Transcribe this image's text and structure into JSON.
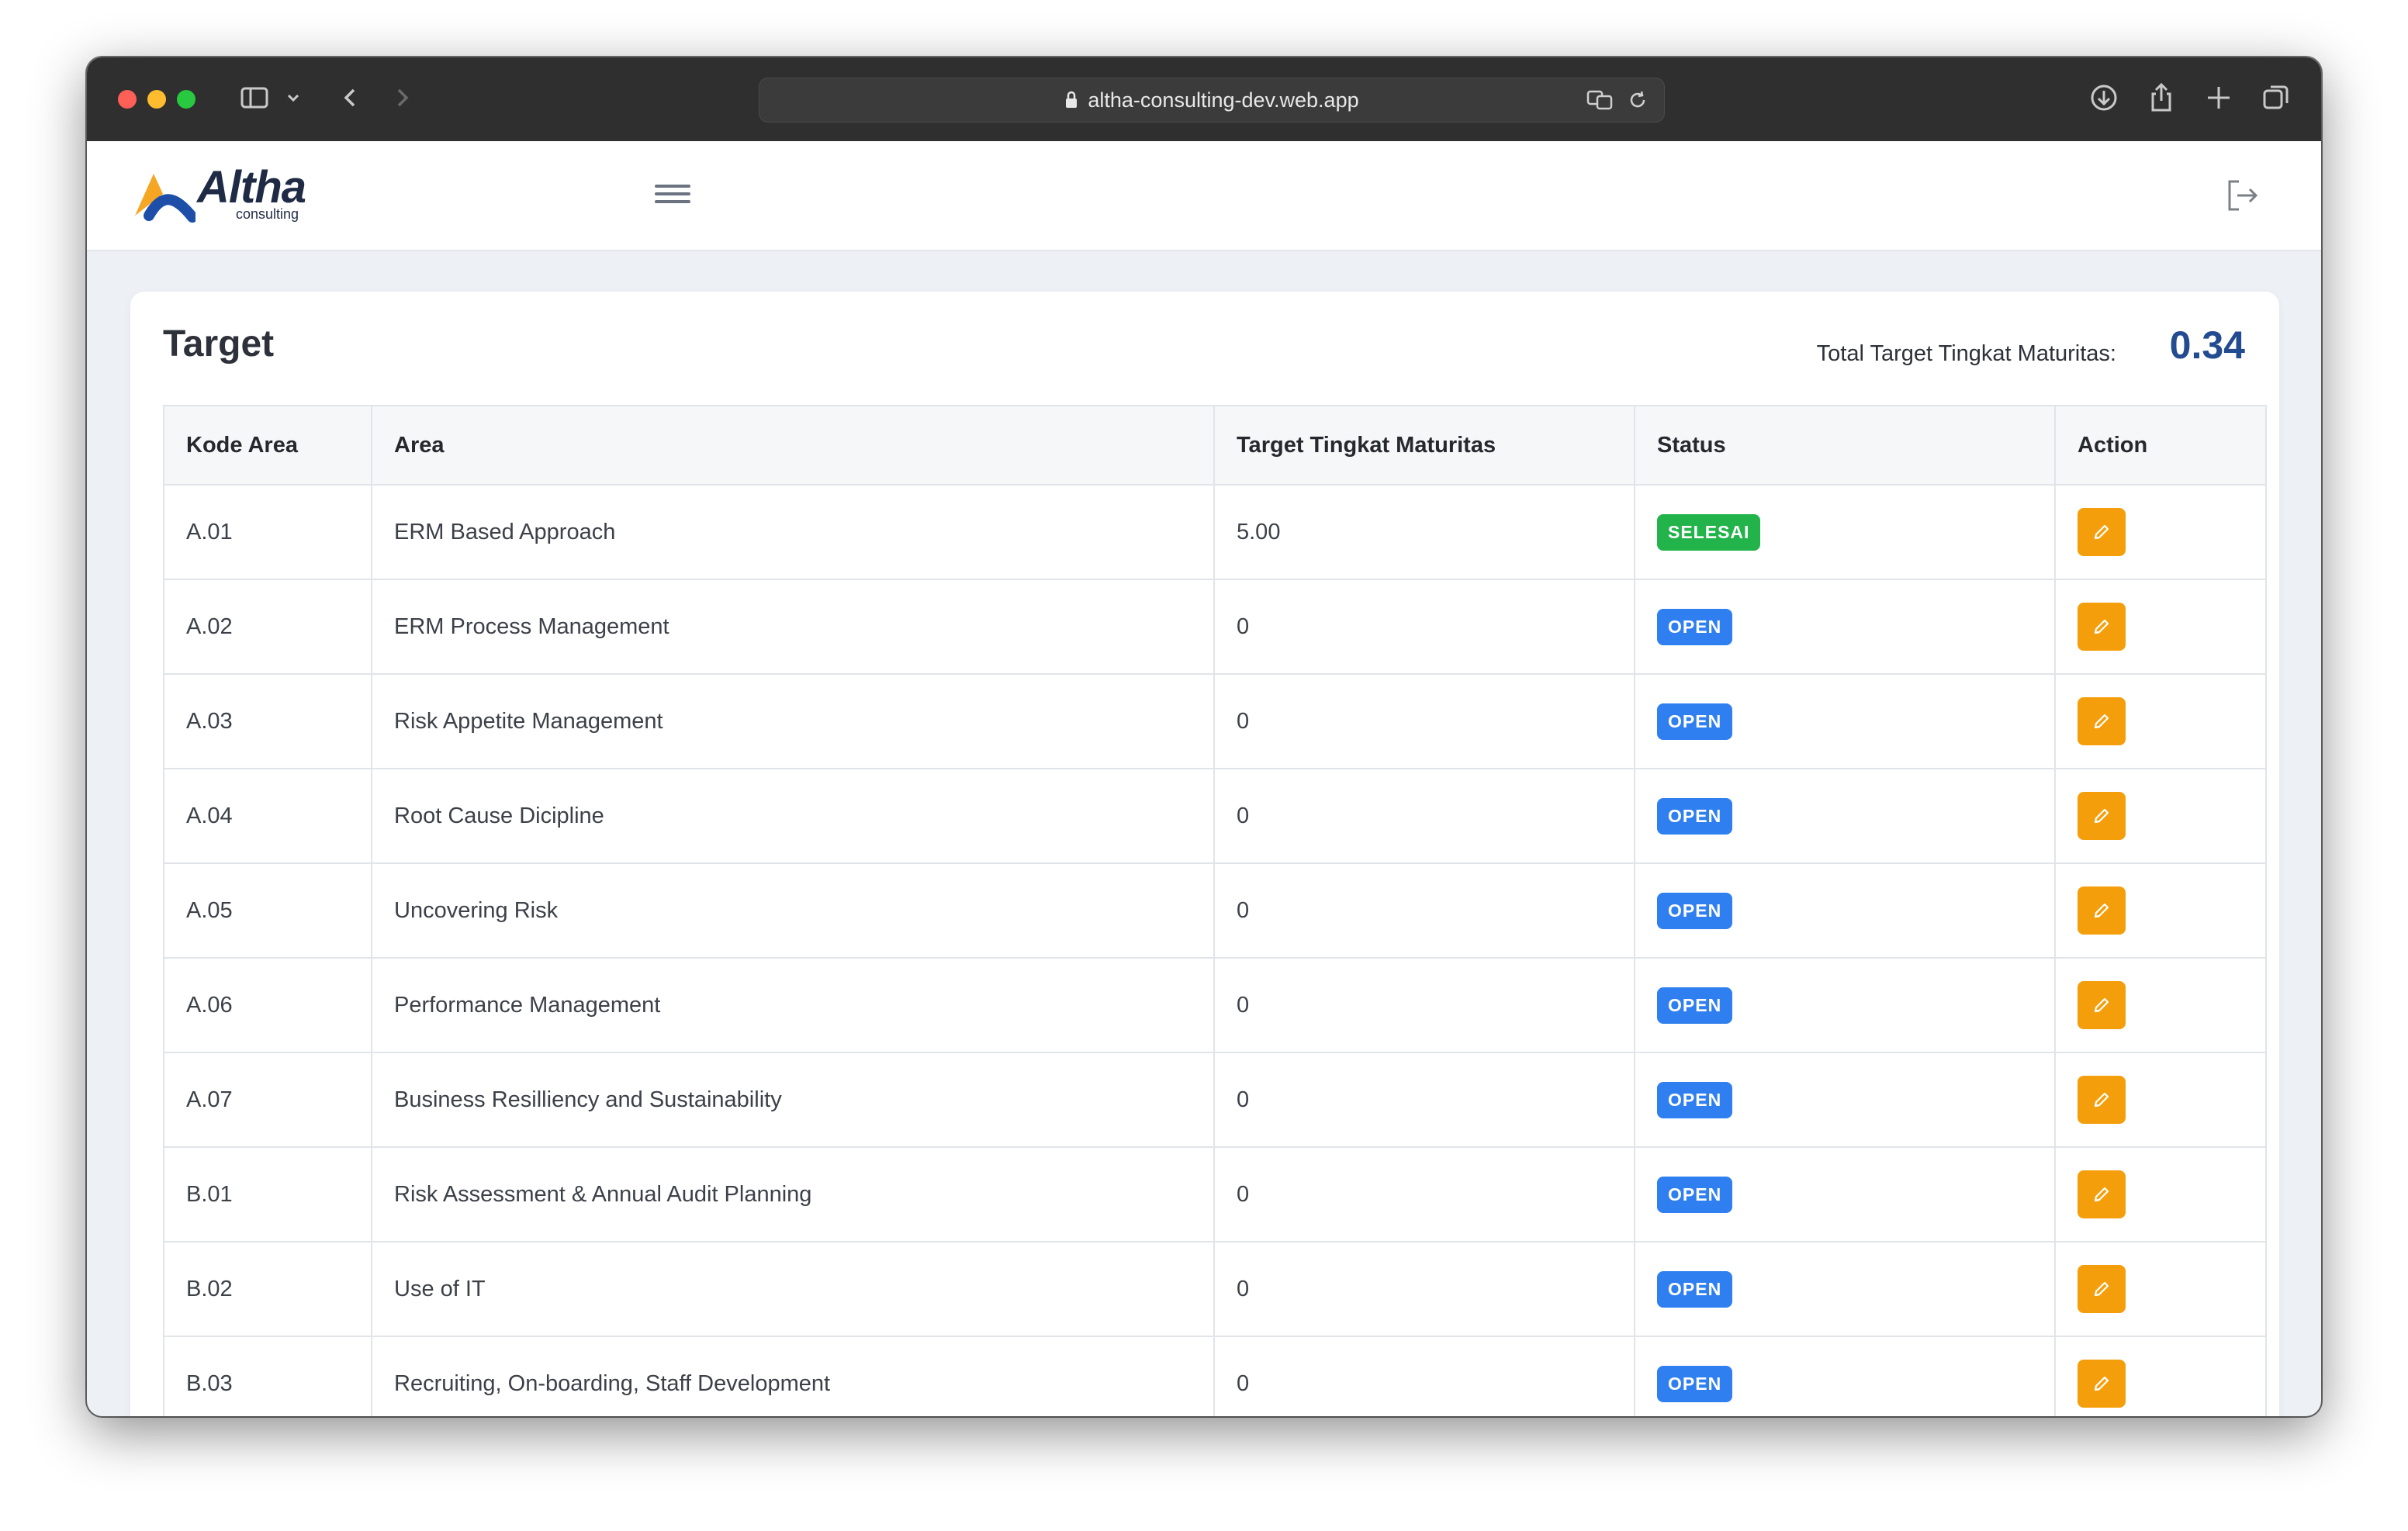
{
  "browser": {
    "url": "altha-consulting-dev.web.app"
  },
  "app": {
    "logo_text": "Altha",
    "logo_sub": "consulting"
  },
  "page": {
    "title": "Target",
    "total_label": "Total Target Tingkat Maturitas:",
    "total_value": "0.34"
  },
  "table": {
    "headers": [
      "Kode Area",
      "Area",
      "Target Tingkat Maturitas",
      "Status",
      "Action"
    ],
    "rows": [
      {
        "code": "A.01",
        "area": "ERM Based Approach",
        "target": "5.00",
        "status": "SELESAI"
      },
      {
        "code": "A.02",
        "area": "ERM Process Management",
        "target": "0",
        "status": "OPEN"
      },
      {
        "code": "A.03",
        "area": "Risk Appetite Management",
        "target": "0",
        "status": "OPEN"
      },
      {
        "code": "A.04",
        "area": "Root Cause Dicipline",
        "target": "0",
        "status": "OPEN"
      },
      {
        "code": "A.05",
        "area": "Uncovering Risk",
        "target": "0",
        "status": "OPEN"
      },
      {
        "code": "A.06",
        "area": "Performance Management",
        "target": "0",
        "status": "OPEN"
      },
      {
        "code": "A.07",
        "area": "Business Resilliency and Sustainability",
        "target": "0",
        "status": "OPEN"
      },
      {
        "code": "B.01",
        "area": "Risk Assessment & Annual Audit Planning",
        "target": "0",
        "status": "OPEN"
      },
      {
        "code": "B.02",
        "area": "Use of IT",
        "target": "0",
        "status": "OPEN"
      },
      {
        "code": "B.03",
        "area": "Recruiting, On-boarding, Staff Development",
        "target": "0",
        "status": "OPEN"
      }
    ]
  },
  "colors": {
    "status_done": "#22b34a",
    "status_open": "#2f7ff0",
    "edit_button": "#f59e0b",
    "total_value": "#234b8f"
  }
}
